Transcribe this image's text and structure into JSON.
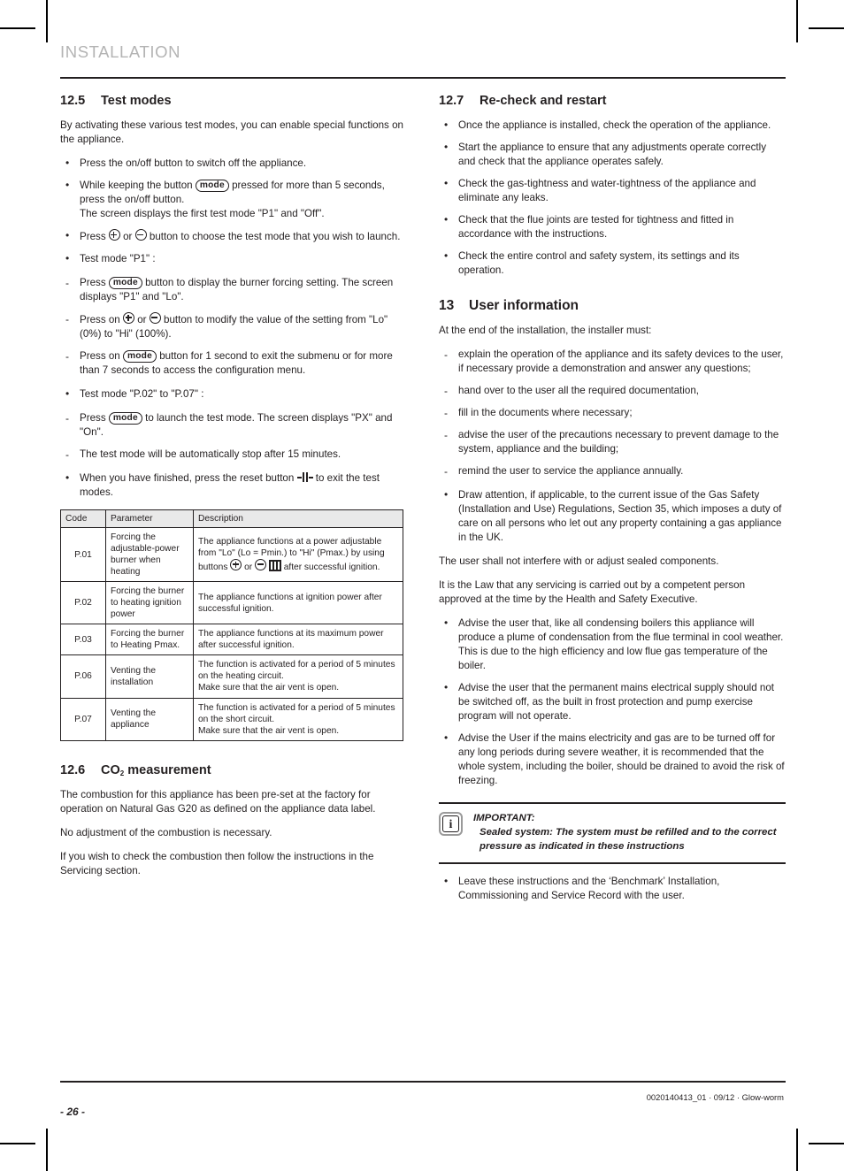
{
  "header": {
    "chapter": "INSTALLATION"
  },
  "left": {
    "s125": {
      "num": "12.5",
      "title": "Test modes",
      "intro": "By activating these various test modes, you can enable special functions on the appliance.",
      "b1": "Press the on/off button to switch off the appliance.",
      "b2_a": "While keeping the button",
      "b2_mode": "mode",
      "b2_b": "pressed for more than 5 seconds, press the on/off button.",
      "b2_c": "The screen displays the first test mode \"P1\" and \"Off\".",
      "b3_a": "Press",
      "b3_or": "or",
      "b3_b": "button to choose the test mode that you wish to launch.",
      "b4": "Test mode \"P1\" :",
      "d1_a": "Press",
      "d1_mode": "mode",
      "d1_b": "button to display the burner forcing setting. The screen displays \"P1\" and \"Lo\".",
      "d2_a": "Press on",
      "d2_or": "or",
      "d2_b": "button to modify the value of the setting from \"Lo\" (0%) to \"Hi\" (100%).",
      "d3_a": "Press on",
      "d3_mode": "mode",
      "d3_b": "button for 1 second to exit the submenu or for more than 7 seconds to access the configuration menu.",
      "b5": "Test mode \"P.02\" to \"P.07\" :",
      "d4_a": "Press",
      "d4_mode": "mode",
      "d4_b": "to launch the test mode. The screen displays \"PX\" and \"On\".",
      "d5": "The test mode will be automatically stop after 15 minutes.",
      "b6_a": "When you have finished, press the reset button",
      "b6_b": "to exit the test modes."
    },
    "table": {
      "headers": [
        "Code",
        "Parameter",
        "Description"
      ],
      "rows": [
        {
          "code": "P.01",
          "param": "Forcing the adjustable-power burner when heating",
          "desc_a": "The appliance functions at a power adjustable from \"Lo\" (Lo = Pmin.) to \"Hi\" (Pmax.) by using buttons",
          "desc_or": "or",
          "desc_b": "after successful ignition."
        },
        {
          "code": "P.02",
          "param": "Forcing the burner to heating ignition power",
          "desc": "The appliance functions at ignition power after successful ignition."
        },
        {
          "code": "P.03",
          "param": "Forcing the burner to Heating Pmax.",
          "desc": "The appliance functions at its maximum power after successful ignition."
        },
        {
          "code": "P.06",
          "param": "Venting the installation",
          "desc": "The function is activated for a period of 5 minutes on the heating circuit.\nMake sure that the air vent is open."
        },
        {
          "code": "P.07",
          "param": "Venting the appliance",
          "desc": "The function is activated for a period of 5 minutes on the short circuit.\nMake sure that the air vent is open."
        }
      ]
    },
    "s126": {
      "num": "12.6",
      "title_a": "CO",
      "title_sub": "2",
      "title_b": " measurement",
      "p1": "The combustion for this appliance has been pre-set at the factory for operation on Natural Gas G20 as defined on the appliance data label.",
      "p2": "No adjustment of the combustion is necessary.",
      "p3": "If you wish to check the combustion then follow the instructions in the Servicing section."
    }
  },
  "right": {
    "s127": {
      "num": "12.7",
      "title": "Re-check and restart",
      "bullets": [
        "Once the appliance is installed, check the operation of the appliance.",
        "Start the appliance to ensure that any adjustments operate correctly and check that the appliance operates safely.",
        "Check the gas-tightness and water-tightness of the appliance and eliminate any leaks.",
        "Check that the flue joints are tested for tightness and fitted in accordance with the instructions.",
        "Check the entire control and safety system, its settings and its operation."
      ]
    },
    "s13": {
      "num": "13",
      "title": "User information",
      "intro": "At the end of the installation, the installer must:",
      "dashes": [
        "explain the operation of the appliance and its safety devices to the user, if necessary provide a demonstration and answer any questions;",
        "hand over to the user all the required documentation,",
        "fill in the documents where necessary;",
        "advise the user of the precautions necessary to prevent damage to the system, appliance and the building;",
        "remind the user to service the appliance annually."
      ],
      "bullet_gas": "Draw attention, if applicable, to the current issue of the Gas Safety (Installation and Use) Regulations, Section 35, which imposes a duty of care on all persons who let out any property containing a gas appliance in the UK.",
      "p_sealed": "The user shall not interfere with or adjust sealed components.",
      "p_law": "It is the Law that any servicing is carried out by a competent person approved at the time by the Health and Safety Executive.",
      "bullets2": [
        "Advise the user that, like all condensing boilers this appliance will produce a plume of condensation from the flue terminal in cool weather. This is due to the high efficiency and low flue gas temperature of the boiler.",
        "Advise the user that the permanent mains electrical supply should not be switched off, as the built in frost protection and pump exercise program will not operate.",
        "Advise the User if the mains electricity and gas are to be turned off for any long periods during severe weather, it is recommended that the whole system, including the boiler, should be drained to avoid the risk of freezing."
      ],
      "info": {
        "icon": "i",
        "line1": "IMPORTANT:",
        "line2": "Sealed system: The system must be refilled and to the correct pressure as indicated in these instructions"
      },
      "bullet_final": "Leave these instructions and the ‘Benchmark’ Installation, Commissioning and Service Record with the user."
    }
  },
  "footer": {
    "page": "- 26 -",
    "code": "0020140413_01 · 09/12 · Glow-worm"
  }
}
